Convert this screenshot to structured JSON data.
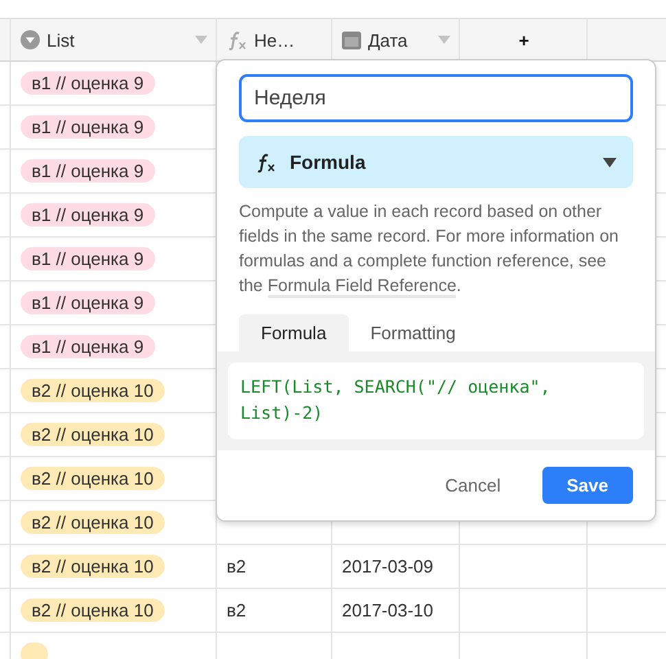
{
  "columns": [
    {
      "kind": "select",
      "label": "List"
    },
    {
      "kind": "formula",
      "label": "Не…"
    },
    {
      "kind": "date",
      "label": "Дата"
    },
    {
      "kind": "add",
      "label": "+"
    }
  ],
  "rows": [
    {
      "list": "в1 // оценка 9",
      "color": "#ffdce5"
    },
    {
      "list": "в1 // оценка 9",
      "color": "#ffdce5"
    },
    {
      "list": "в1 // оценка 9",
      "color": "#ffdce5"
    },
    {
      "list": "в1 // оценка 9",
      "color": "#ffdce5"
    },
    {
      "list": "в1 // оценка 9",
      "color": "#ffdce5"
    },
    {
      "list": "в1 // оценка 9",
      "color": "#ffdce5"
    },
    {
      "list": "в1 // оценка 9",
      "color": "#ffdce5"
    },
    {
      "list": "в2 // оценка 10",
      "color": "#ffeab6"
    },
    {
      "list": "в2 // оценка 10",
      "color": "#ffeab6"
    },
    {
      "list": "в2 // оценка 10",
      "color": "#ffeab6"
    },
    {
      "list": "в2 // оценка 10",
      "color": "#ffeab6"
    },
    {
      "list": "в2 // оценка 10",
      "color": "#ffeab6",
      "week": "в2",
      "date": "2017-03-09"
    },
    {
      "list": "в2 // оценка 10",
      "color": "#ffeab6",
      "week": "в2",
      "date": "2017-03-10"
    },
    {
      "color": "#ffeab6"
    }
  ],
  "field_editor": {
    "name": "Неделя",
    "type": "Formula",
    "description": "Compute a value in each record based on other fields in the same record. For more information on formulas and a complete function reference, see the ",
    "link": "Formula Field Reference",
    "after_link": ".",
    "tabs": [
      {
        "label": "Formula",
        "selected": true
      },
      {
        "label": "Formatting",
        "selected": false
      }
    ],
    "formula": "LEFT(List, SEARCH(\"// оценка\", List)-2)",
    "buttons": [
      {
        "kind": "cancel",
        "label": "Cancel"
      },
      {
        "kind": "save",
        "label": "Save"
      }
    ]
  }
}
